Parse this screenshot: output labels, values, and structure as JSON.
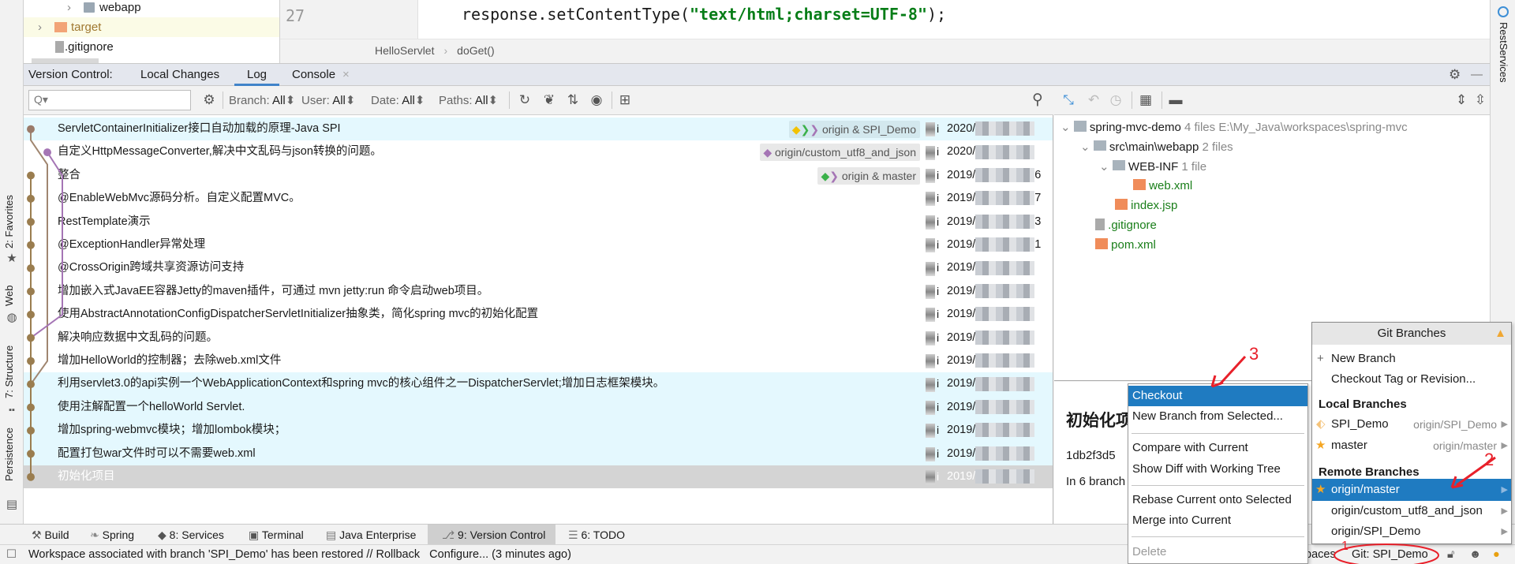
{
  "project_tree": {
    "items": [
      {
        "label": "webapp"
      },
      {
        "label": "target"
      },
      {
        "label": ".gitignore"
      }
    ]
  },
  "editor": {
    "line_number": "27",
    "code_prefix": "response.setContentType(",
    "code_string": "\"text/html;charset=UTF-8\"",
    "code_suffix": ");"
  },
  "breadcrumb": [
    "HelloServlet",
    "doGet()"
  ],
  "right_stripe": {
    "label": "RestServices"
  },
  "left_stripe": {
    "items": [
      {
        "label": "2: Favorites"
      },
      {
        "label": "Web"
      },
      {
        "label": "7: Structure"
      },
      {
        "label": "Persistence"
      }
    ]
  },
  "vc_tabs": {
    "title": "Version Control:",
    "tabs": [
      {
        "label": "Local Changes"
      },
      {
        "label": "Log",
        "active": true
      },
      {
        "label": "Console"
      }
    ]
  },
  "log_toolbar": {
    "search_placeholder": "Q▾",
    "filters": [
      {
        "label": "Branch:",
        "value": "All"
      },
      {
        "label": "User:",
        "value": "All"
      },
      {
        "label": "Date:",
        "value": "All"
      },
      {
        "label": "Paths:",
        "value": "All"
      }
    ]
  },
  "commits": [
    {
      "subject": "ServletContainerInitializer接口自动加载的原理-Java SPI",
      "ref": "origin & SPI_Demo",
      "author": "i",
      "date": "2020/",
      "date_tail": "",
      "state": "hl"
    },
    {
      "subject": "自定义HttpMessageConverter,解决中文乱码与json转换的问题。",
      "ref": "origin/custom_utf8_and_json",
      "author": "i",
      "date": "2020/",
      "date_tail": "",
      "state": ""
    },
    {
      "subject": "整合",
      "ref": "origin & master",
      "author": "i",
      "date": "2019/",
      "date_tail": "6",
      "state": ""
    },
    {
      "subject": "@EnableWebMvc源码分析。自定义配置MVC。",
      "ref": "",
      "author": "i",
      "date": "2019/",
      "date_tail": "7",
      "state": ""
    },
    {
      "subject": "RestTemplate演示",
      "ref": "",
      "author": "i",
      "date": "2019/",
      "date_tail": "3",
      "state": ""
    },
    {
      "subject": "@ExceptionHandler异常处理",
      "ref": "",
      "author": "i",
      "date": "2019/",
      "date_tail": "1",
      "state": ""
    },
    {
      "subject": "@CrossOrigin跨域共享资源访问支持",
      "ref": "",
      "author": "i",
      "date": "2019/",
      "date_tail": "",
      "state": ""
    },
    {
      "subject": "增加嵌入式JavaEE容器Jetty的maven插件，可通过 mvn jetty:run 命令启动web项目。",
      "ref": "",
      "author": "i",
      "date": "2019/",
      "date_tail": "",
      "state": ""
    },
    {
      "subject": "使用AbstractAnnotationConfigDispatcherServletInitializer抽象类，简化spring mvc的初始化配置",
      "ref": "",
      "author": "i",
      "date": "2019/",
      "date_tail": "",
      "state": ""
    },
    {
      "subject": "解决响应数据中文乱码的问题。",
      "ref": "",
      "author": "i",
      "date": "2019/",
      "date_tail": "",
      "state": ""
    },
    {
      "subject": "增加HelloWorld的控制器；去除web.xml文件",
      "ref": "",
      "author": "i",
      "date": "2019/",
      "date_tail": "",
      "state": ""
    },
    {
      "subject": "利用servlet3.0的api实例一个WebApplicationContext和spring mvc的核心组件之一DispatcherServlet;增加日志框架模块。",
      "ref": "",
      "author": "i",
      "date": "2019/",
      "date_tail": "",
      "state": "hl"
    },
    {
      "subject": "使用注解配置一个helloWorld Servlet.",
      "ref": "",
      "author": "i",
      "date": "2019/",
      "date_tail": "",
      "state": "hl"
    },
    {
      "subject": "增加spring-webmvc模块；增加lombok模块；",
      "ref": "",
      "author": "i",
      "date": "2019/",
      "date_tail": "",
      "state": "hl"
    },
    {
      "subject": "配置打包war文件时可以不需要web.xml",
      "ref": "",
      "author": "i",
      "date": "2019/",
      "date_tail": "",
      "state": "hl"
    },
    {
      "subject": "初始化项目",
      "ref": "",
      "author": "i",
      "date": "2019/",
      "date_tail": "",
      "state": "sel"
    }
  ],
  "colors": {
    "graph_main": "#9a7d4f",
    "graph_branch": "#a08670",
    "graph_purple": "#a575b5",
    "selection": "#1f7bc1",
    "annotation": "#e8202a"
  },
  "changes": {
    "root": {
      "name": "spring-mvc-demo",
      "count": "4 files",
      "path": "E:\\My_Java\\workspaces\\spring-mvc"
    },
    "dir": {
      "name": "src\\main\\webapp",
      "count": "2 files"
    },
    "webinf": {
      "name": "WEB-INF",
      "count": "1 file"
    },
    "files": [
      "web.xml",
      "index.jsp",
      ".gitignore",
      "pom.xml"
    ]
  },
  "details": {
    "title": "初始化项目",
    "hash": "1db2f3d5",
    "branches": "In 6 branch"
  },
  "tool_windows": [
    {
      "label": "Build"
    },
    {
      "label": "Spring"
    },
    {
      "label": "8: Services"
    },
    {
      "label": "Terminal"
    },
    {
      "label": "Java Enterprise"
    },
    {
      "label": "9: Version Control"
    },
    {
      "label": "6: TODO"
    }
  ],
  "status": {
    "message": "Workspace associated with branch 'SPI_Demo' has been restored // Rollback   Configure... (3 minutes ago)",
    "workspaces": "paces",
    "git_branch": "Git: SPI_Demo"
  },
  "context_menu": {
    "items": [
      "Checkout",
      "New Branch from Selected...",
      "Compare with Current",
      "Show Diff with Working Tree",
      "Rebase Current onto Selected",
      "Merge into Current",
      "Delete"
    ]
  },
  "git_branches": {
    "title": "Git Branches",
    "new_branch": "New Branch",
    "checkout_tag": "Checkout Tag or Revision...",
    "local_header": "Local Branches",
    "local": [
      {
        "name": "SPI_Demo",
        "tracking": "origin/SPI_Demo"
      },
      {
        "name": "master",
        "tracking": "origin/master"
      }
    ],
    "remote_header": "Remote Branches",
    "remote": [
      {
        "name": "origin/master"
      },
      {
        "name": "origin/custom_utf8_and_json"
      },
      {
        "name": "origin/SPI_Demo"
      }
    ]
  },
  "annotations": [
    "1",
    "2",
    "3"
  ]
}
